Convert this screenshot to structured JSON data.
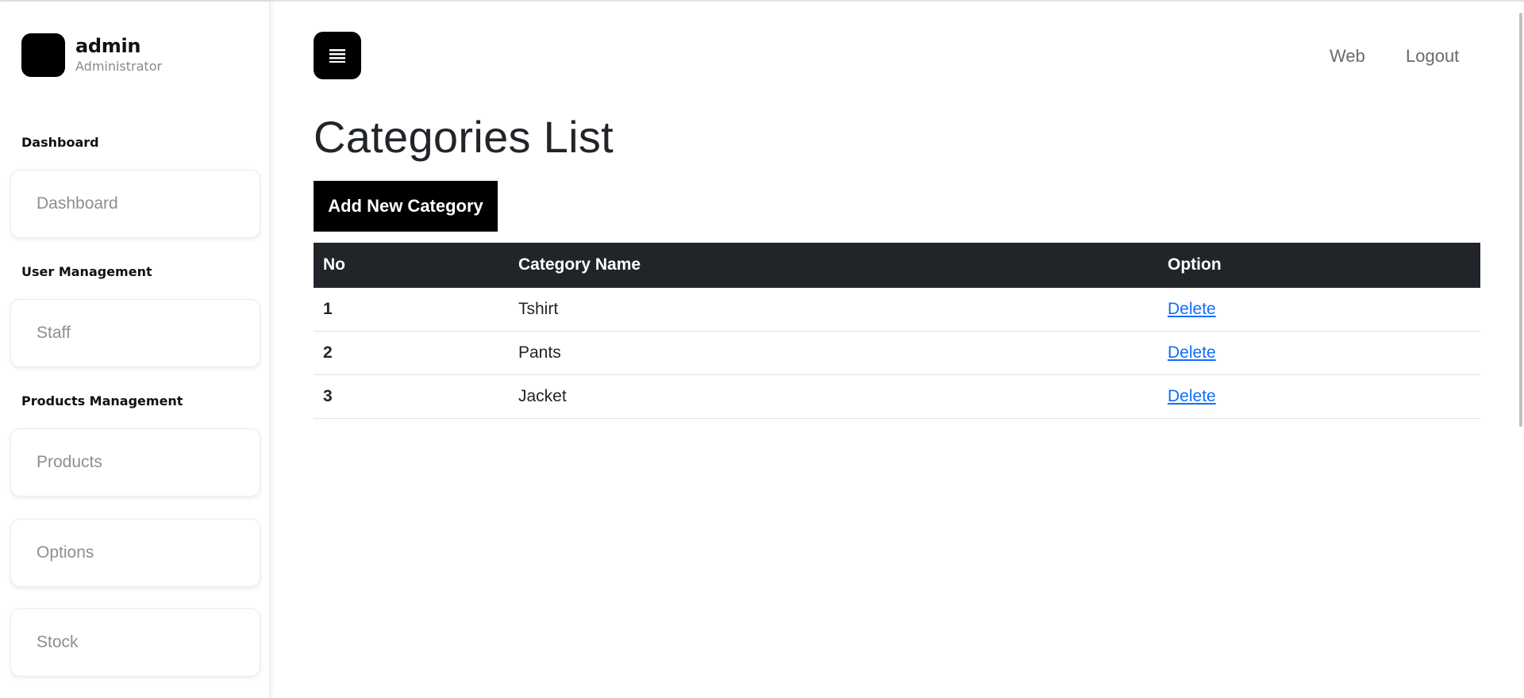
{
  "sidebar": {
    "profile": {
      "name": "admin",
      "role": "Administrator"
    },
    "sections": {
      "dashboard": {
        "title": "Dashboard",
        "items": [
          "Dashboard"
        ]
      },
      "user_management": {
        "title": "User Management",
        "items": [
          "Staff"
        ]
      },
      "products_management": {
        "title": "Products Management",
        "items": [
          "Products",
          "Options",
          "Stock"
        ]
      }
    }
  },
  "header": {
    "menu_icon": "hamburger-menu-icon",
    "links": {
      "web": "Web",
      "logout": "Logout"
    }
  },
  "main": {
    "title": "Categories List",
    "add_button_label": "Add New Category",
    "table": {
      "columns": [
        "No",
        "Category Name",
        "Option"
      ],
      "rows": [
        {
          "no": "1",
          "name": "Tshirt",
          "option": "Delete"
        },
        {
          "no": "2",
          "name": "Pants",
          "option": "Delete"
        },
        {
          "no": "3",
          "name": "Jacket",
          "option": "Delete"
        }
      ]
    }
  },
  "colors": {
    "accent": "#000000",
    "table_header": "#212529",
    "link": "#0d6efd",
    "muted_text": "#8e8e8e"
  }
}
